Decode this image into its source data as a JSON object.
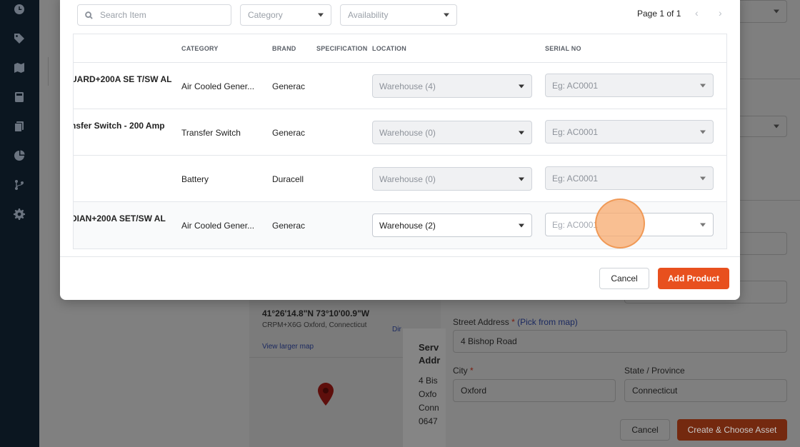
{
  "modal": {
    "search_placeholder": "Search Item",
    "category_placeholder": "Category",
    "availability_placeholder": "Availability",
    "pagination": "Page 1 of 1",
    "prev_glyph": "‹",
    "next_glyph": "›",
    "columns": {
      "category": "CATEGORY",
      "brand": "BRAND",
      "specification": "SPECIFICATION",
      "location": "LOCATION",
      "serial": "SERIAL NO"
    },
    "rows": [
      {
        "name": "UARD+200A SE T/SW AL",
        "category": "Air Cooled Gener...",
        "brand": "Generac",
        "location": "Warehouse (4)",
        "serial_placeholder": "Eg: AC0001",
        "enabled": false
      },
      {
        "name": "nsfer Switch - 200 Amp",
        "category": "Transfer Switch",
        "brand": "Generac",
        "location": "Warehouse (0)",
        "serial_placeholder": "Eg: AC0001",
        "enabled": false
      },
      {
        "name": "",
        "category": "Battery",
        "brand": "Duracell",
        "location": "Warehouse (0)",
        "serial_placeholder": "Eg: AC0001",
        "enabled": false
      },
      {
        "name": "DIAN+200A SET/SW AL",
        "category": "Air Cooled Gener...",
        "brand": "Generac",
        "location": "Warehouse (2)",
        "serial_placeholder": "Eg: AC0001",
        "enabled": true
      }
    ],
    "cancel_label": "Cancel",
    "add_label": "Add Product"
  },
  "background": {
    "map": {
      "coords": "41°26'14.8\"N 73°10'00.9\"W",
      "plus_code": "CRPM+X6G Oxford, Connecticut",
      "view_larger": "View larger map",
      "directions": "Dir"
    },
    "popup": {
      "title": "Serv\nAddr",
      "address": "4 Bis\nOxfo\nConn\n0647"
    },
    "form": {
      "street_label": "Street Address",
      "pick_from_map": "(Pick from map)",
      "street_value": "4 Bishop Road",
      "city_label": "City",
      "city_value": "Oxford",
      "state_label": "State / Province",
      "state_value": "Connecticut",
      "required_mark": "*",
      "cancel_label": "Cancel",
      "create_label": "Create & Choose Asset"
    }
  },
  "colors": {
    "accent": "#e8501e",
    "sidebar": "#0b1620"
  },
  "icons": [
    "clock-icon",
    "tag-icon",
    "map-icon",
    "calculator-icon",
    "documents-icon",
    "pie-chart-icon",
    "branch-icon",
    "gear-icon",
    "search-icon",
    "chevron-down-icon",
    "map-pin-icon"
  ]
}
